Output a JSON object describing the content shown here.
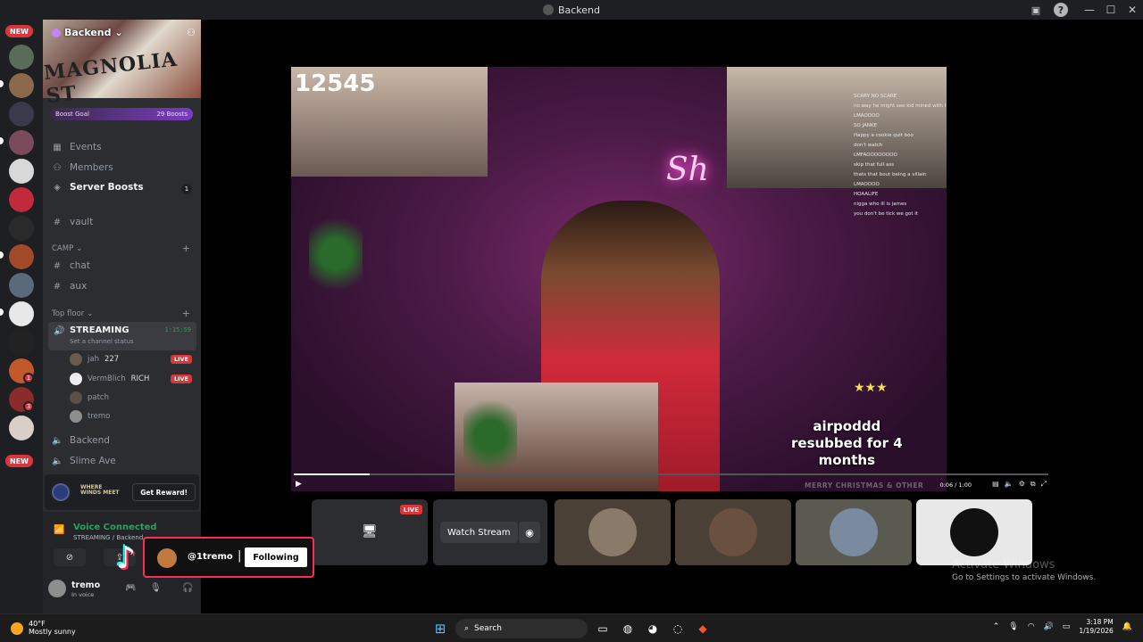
{
  "window": {
    "title": "Backend"
  },
  "rail": {
    "new_top": "NEW",
    "new_bottom": "NEW",
    "mention_1": "1",
    "mention_2": "3"
  },
  "server": {
    "name": "Backend",
    "banner_text": "MAGNOLIA ST",
    "boost_goal": "Boost Goal",
    "boost_count": "29 Boosts"
  },
  "nav": {
    "events": "Events",
    "members": "Members",
    "server_boosts": "Server Boosts",
    "server_boosts_count": "1",
    "vault": "vault"
  },
  "categories": {
    "camp": "CAMP",
    "top_floor": "Top floor"
  },
  "channels": {
    "chat": "chat",
    "aux": "aux",
    "streaming": "STREAMING",
    "streaming_status": "Set a channel status",
    "streaming_time": "1:15:59",
    "backend": "Backend",
    "slime_ave": "Slime Ave"
  },
  "voice_users": [
    {
      "name": "jah",
      "tag": "227",
      "live": "LIVE"
    },
    {
      "name": "VermBlich",
      "tag": "RICH",
      "live": "LIVE"
    },
    {
      "name": "patch"
    },
    {
      "name": "tremo"
    }
  ],
  "promo": {
    "brand_line1": "WHERE",
    "brand_line2": "WINDS MEET",
    "button": "Get Reward!"
  },
  "voice_panel": {
    "status": "Voice Connected",
    "location": "STREAMING / Backend"
  },
  "user": {
    "name": "tremo",
    "status": "In voice"
  },
  "stream": {
    "overlay_number": "12545",
    "neon_sign": "Sh",
    "sub_text": "airpoddd\nresubbed for 4\nmonths",
    "banner_text": "MERRY CHRISTMAS & OTHER",
    "timecode": "0:06 / 1:00",
    "progress": 0.1,
    "chat_lines": [
      {
        "user": "",
        "text": "SCARY NO SCARE"
      },
      {
        "user": "",
        "text": "no way he might see kid mined with this hair style"
      },
      {
        "user": "",
        "text": "LMAOOOO"
      },
      {
        "user": "",
        "text": "SO JANKE"
      },
      {
        "user": "",
        "text": "Happy a cookie quit boo"
      },
      {
        "user": "",
        "text": "don't watch"
      },
      {
        "user": "",
        "text": "LMFAOOOOOOOO"
      },
      {
        "user": "",
        "text": "skip that full ass"
      },
      {
        "user": "",
        "text": "thats that bout being a villain"
      },
      {
        "user": "",
        "text": "LMAOOOO"
      },
      {
        "user": "",
        "text": "HOAALIFE"
      },
      {
        "user": "",
        "text": "nigga who ill is james"
      },
      {
        "user": "",
        "text": "you don't be tick we got it"
      }
    ]
  },
  "tiles": {
    "live": "LIVE",
    "watch_stream": "Watch Stream"
  },
  "tiktok": {
    "handle": "@1tremo",
    "separator": "|",
    "button": "Following"
  },
  "windows": {
    "activate_title": "Activate Windows",
    "activate_sub": "Go to Settings to activate Windows."
  },
  "taskbar": {
    "temp": "40°F",
    "weather": "Mostly sunny",
    "search": "Search",
    "time": "3:18 PM",
    "date": "1/19/2026"
  }
}
